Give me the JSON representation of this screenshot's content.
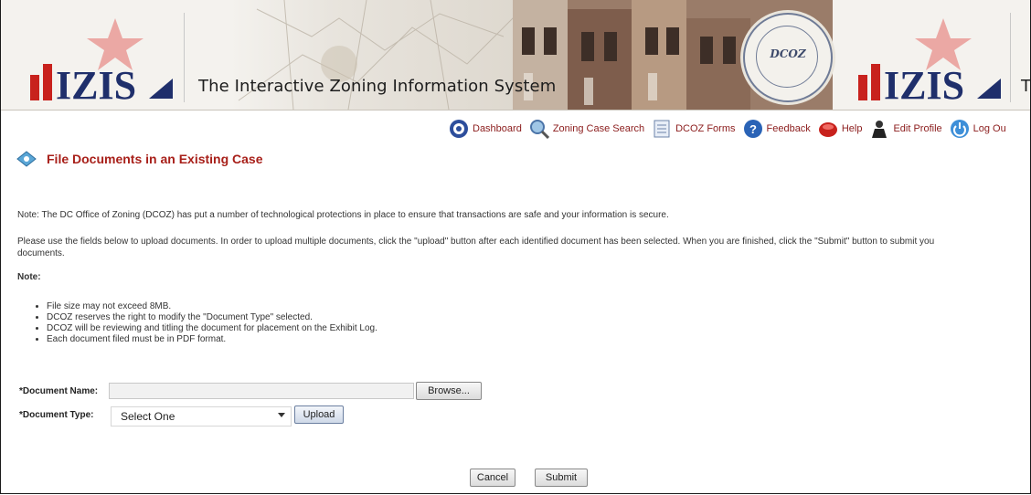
{
  "banner": {
    "logo_text": "IZIS",
    "tagline": "The Interactive Zoning Information System",
    "seal_text": "DCOZ",
    "seal_ring_top": "DISTRICT OF COLUMBIA",
    "seal_ring_bottom": "OFFICE OF ZONING",
    "tagline_right_first_letter": "T"
  },
  "nav": {
    "items": [
      {
        "label": "Dashboard",
        "icon": "dashboard-icon"
      },
      {
        "label": "Zoning Case Search",
        "icon": "search-icon"
      },
      {
        "label": "DCOZ Forms",
        "icon": "forms-icon"
      },
      {
        "label": "Feedback",
        "icon": "feedback-icon"
      },
      {
        "label": "Help",
        "icon": "help-icon"
      },
      {
        "label": "Edit Profile",
        "icon": "profile-icon"
      },
      {
        "label": "Log Ou",
        "icon": "power-icon"
      }
    ]
  },
  "page": {
    "title": "File Documents in an Existing Case",
    "note_security": "Note: The DC Office of Zoning (DCOZ) has put a number of technological protections in place to ensure that transactions are safe and your information is secure.",
    "instructions_line1": "Please use the fields below to upload documents. In order to upload multiple documents, click the \"upload\" button after each identified document has been selected. When you are finished, click the \"Submit\" button to submit you",
    "instructions_line2": "documents.",
    "note_label": "Note:",
    "bullets": [
      "File size may not exceed 8MB.",
      "DCOZ reserves the right to modify the \"Document Type\" selected.",
      "DCOZ will be reviewing and titling the document for placement on the Exhibit Log.",
      "Each document filed must be in PDF format."
    ]
  },
  "form": {
    "document_name_label": "*Document Name:",
    "document_name_value": "",
    "browse_label": "Browse...",
    "document_type_label": "*Document Type:",
    "document_type_selected": "Select One",
    "upload_label": "Upload",
    "cancel_label": "Cancel",
    "submit_label": "Submit"
  },
  "colors": {
    "title_red": "#a8201a",
    "nav_text": "#8b1c1c",
    "logo_red": "#c8221d",
    "logo_navy": "#1f2f6b"
  }
}
